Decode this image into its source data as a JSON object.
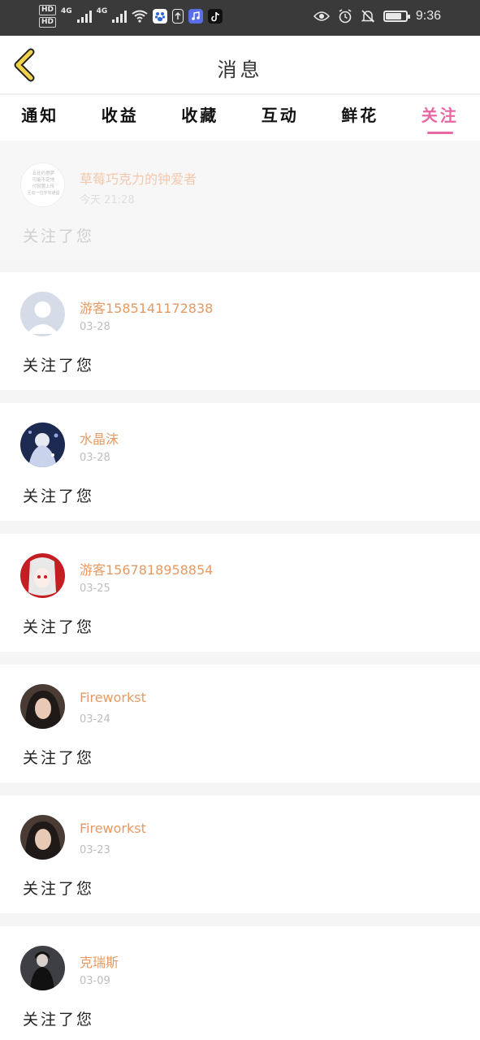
{
  "status_bar": {
    "hd1": "HD",
    "hd2": "HD",
    "net1": "4G",
    "net2": "4G",
    "time": "9:36",
    "icons": [
      "wifi-icon",
      "baidu-icon",
      "upload-icon",
      "music-icon",
      "tiktok-icon",
      "eye-icon",
      "alarm-icon",
      "mute-icon",
      "battery-icon"
    ]
  },
  "header": {
    "title": "消息"
  },
  "tabs": [
    {
      "label": "通知",
      "active": false
    },
    {
      "label": "收益",
      "active": false
    },
    {
      "label": "收藏",
      "active": false
    },
    {
      "label": "互动",
      "active": false
    },
    {
      "label": "鲜花",
      "active": false
    },
    {
      "label": "关注",
      "active": true
    }
  ],
  "messages": [
    {
      "name": "草莓巧克力的钟爱者",
      "date": "今天 21:28",
      "action": "关注了您",
      "avatar_text": [
        "丘比约惠萨",
        "可能不定地",
        "付就罢上传",
        "互动一位字年通留"
      ]
    },
    {
      "name": "游客1585141172838",
      "date": "03-28",
      "action": "关注了您",
      "avatar": "default"
    },
    {
      "name": "水晶沫",
      "date": "03-28",
      "action": "关注了您",
      "avatar": "anime-blue"
    },
    {
      "name": "游客1567818958854",
      "date": "03-25",
      "action": "关注了您",
      "avatar": "anime-red"
    },
    {
      "name": "Fireworkst",
      "date": "03-24",
      "action": "关注了您",
      "avatar": "photo-girl"
    },
    {
      "name": "Fireworkst",
      "date": "03-23",
      "action": "关注了您",
      "avatar": "photo-girl"
    },
    {
      "name": "克瑞斯",
      "date": "03-09",
      "action": "关注了您",
      "avatar": "photo-dark"
    }
  ],
  "colors": {
    "accent": "#e868a4",
    "username": "#e59a64",
    "back_arrow": "#f2d24a"
  }
}
